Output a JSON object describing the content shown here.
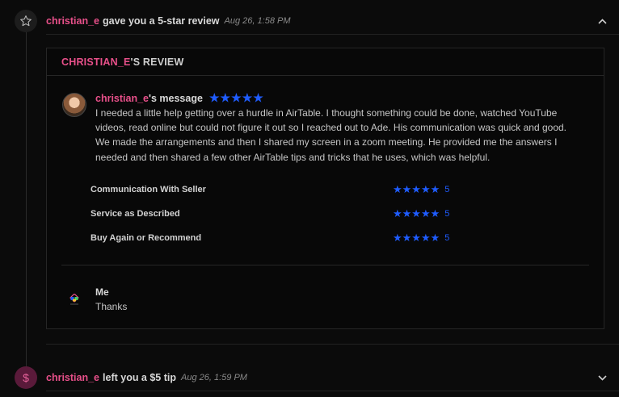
{
  "event1": {
    "username": "christian_e",
    "action": "gave you a 5-star review",
    "date": "Aug 26, 1:58 PM"
  },
  "review": {
    "title_name": "CHRISTIAN_E",
    "title_suffix": "'S REVIEW",
    "message_name": "christian_e",
    "message_suffix": "'s message",
    "overall_stars": 5,
    "message": "I needed a little help getting over a hurdle in AirTable. I thought something could be done, watched YouTube videos, read online but could not figure it out so I reached out to Ade. His communication was quick and good. We made the arrangements and then I shared my screen in a zoom meeting. He provided me the answers I needed and then shared a few other AirTable tips and tricks that he uses, which was helpful.",
    "ratings": [
      {
        "label": "Communication With Seller",
        "score": "5"
      },
      {
        "label": "Service as Described",
        "score": "5"
      },
      {
        "label": "Buy Again or Recommend",
        "score": "5"
      }
    ],
    "reply": {
      "name": "Me",
      "text": "Thanks"
    }
  },
  "event2": {
    "username": "christian_e",
    "action": "left you a $5 tip",
    "date": "Aug 26, 1:59 PM"
  },
  "colors": {
    "accent_pink": "#e8508a",
    "star_blue": "#1f5cff",
    "background": "#0b0b0b"
  },
  "icons": {
    "event1": "star-outline-icon",
    "event2": "dollar-icon",
    "collapse": "chevron-up-icon",
    "expand": "chevron-down-icon"
  }
}
